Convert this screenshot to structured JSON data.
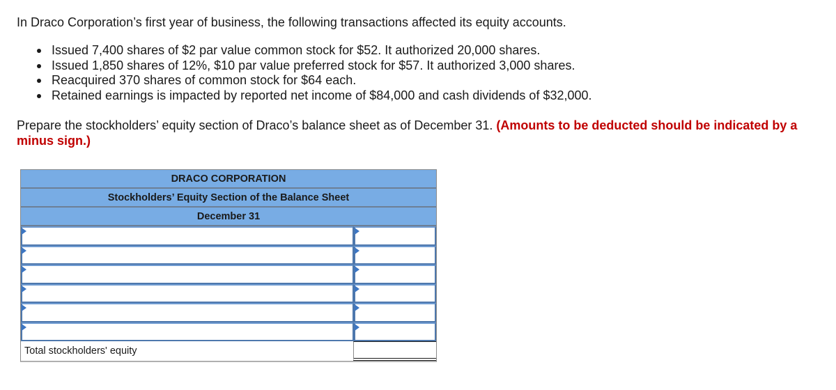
{
  "question": {
    "intro": "In Draco Corporation’s first year of business, the following transactions affected its equity accounts.",
    "transactions": [
      "Issued 7,400 shares of $2 par value common stock for $52. It authorized 20,000 shares.",
      "Issued 1,850 shares of 12%, $10 par value preferred stock for $57. It authorized 3,000 shares.",
      "Reacquired 370 shares of common stock for $64 each.",
      "Retained earnings is impacted by reported net income of $84,000 and cash dividends of $32,000."
    ],
    "prompt": "Prepare the stockholders’ equity section of Draco’s balance sheet as of December 31.",
    "note": "(Amounts to be deducted should be indicated by a minus sign.)",
    "note_color": "#c00000"
  },
  "worksheet": {
    "header_color": "#78ace4",
    "company": "DRACO CORPORATION",
    "statement": "Stockholders’ Equity Section of the Balance Sheet",
    "date": "December 31",
    "rows": [
      {
        "label": "",
        "amount": ""
      },
      {
        "label": "",
        "amount": ""
      },
      {
        "label": "",
        "amount": ""
      },
      {
        "label": "",
        "amount": ""
      },
      {
        "label": "",
        "amount": ""
      },
      {
        "label": "",
        "amount": ""
      }
    ],
    "total_label": "Total stockholders' equity",
    "total_amount": ""
  }
}
